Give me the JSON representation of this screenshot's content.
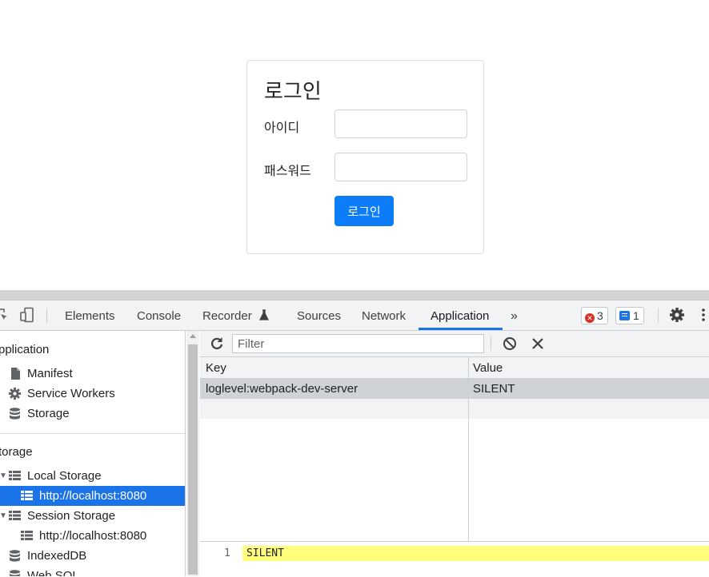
{
  "login": {
    "title": "로그인",
    "id_label": "아이디",
    "id_value": "",
    "password_label": "패스워드",
    "password_value": "",
    "submit_label": "로그인",
    "button_color": "#0d7df7"
  },
  "devtools": {
    "tabs": [
      "Elements",
      "Console",
      "Recorder",
      "Sources",
      "Network",
      "Application"
    ],
    "active_tab": "Application",
    "more_tabs_icon": "chevron-double-right-icon",
    "error_count": "3",
    "message_count": "1",
    "accent_color": "#1a73e8"
  },
  "sidebar": {
    "application_header": "pplication",
    "application_items": [
      "Manifest",
      "Service Workers",
      "Storage"
    ],
    "storage_header": "torage",
    "local_storage": "Local Storage",
    "local_storage_origin": "http://localhost:8080",
    "session_storage": "Session Storage",
    "session_storage_origin": "http://localhost:8080",
    "indexeddb": "IndexedDB",
    "websql": "Web SQL"
  },
  "storage_view": {
    "filter_placeholder": "Filter",
    "filter_value": "",
    "columns": [
      "Key",
      "Value"
    ],
    "rows": [
      {
        "key": "loglevel:webpack-dev-server",
        "value": "SILENT"
      }
    ],
    "preview_line_number": "1",
    "preview_text": "SILENT"
  }
}
